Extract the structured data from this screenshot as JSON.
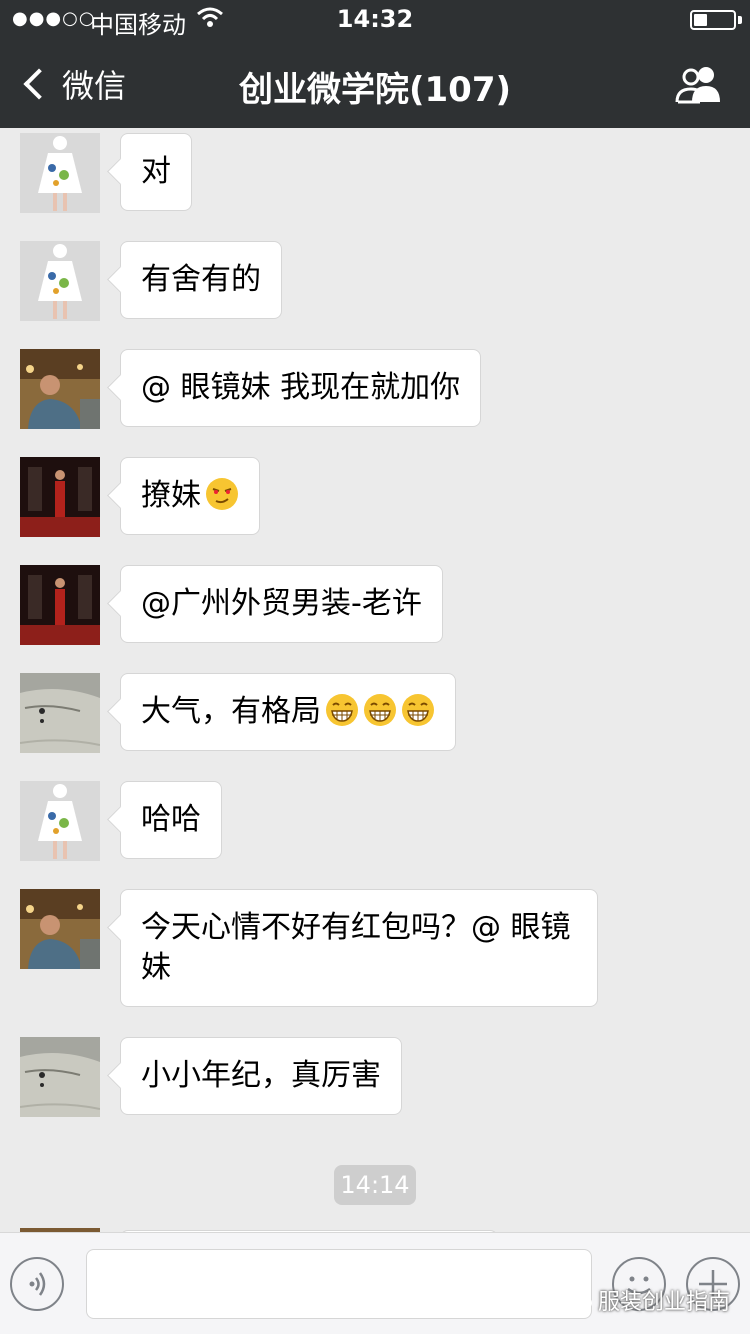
{
  "status_bar": {
    "signal": "●●●○○",
    "carrier": "中国移动",
    "time": "14:32",
    "battery_level": 0.35
  },
  "nav": {
    "back_label": "微信",
    "title": "创业微学院(107)",
    "members_icon": "members-icon"
  },
  "messages": [
    {
      "avatar": "girl-dress",
      "text": "对"
    },
    {
      "avatar": "girl-dress",
      "text": "有舍有的"
    },
    {
      "avatar": "man-cafe",
      "text": "@ 眼镜妹 我现在就加你"
    },
    {
      "avatar": "stage-man",
      "text": "撩妹",
      "emoji": [
        "smirk-emoji"
      ]
    },
    {
      "avatar": "stage-man",
      "text": "@广州外贸男装-老许"
    },
    {
      "avatar": "ink-painting",
      "text": "大气，有格局",
      "emoji": [
        "grin-emoji",
        "grin-emoji",
        "grin-emoji"
      ]
    },
    {
      "avatar": "girl-dress",
      "text": "哈哈"
    },
    {
      "avatar": "man-cafe",
      "text": "今天心情不好有红包吗？@ 眼镜妹"
    },
    {
      "avatar": "ink-painting",
      "text": "小小年纪，真厉害"
    }
  ],
  "time_divider": "14:14",
  "input": {
    "voice_icon": "voice-icon",
    "placeholder": "",
    "emoji_icon": "emoji-icon",
    "plus_icon": "plus-icon"
  },
  "watermark": "服装创业指南",
  "colors": {
    "bar_bg": "#2e3133",
    "chat_bg": "#ebebeb",
    "bubble_bg": "#ffffff",
    "time_chip": "#cecece"
  }
}
